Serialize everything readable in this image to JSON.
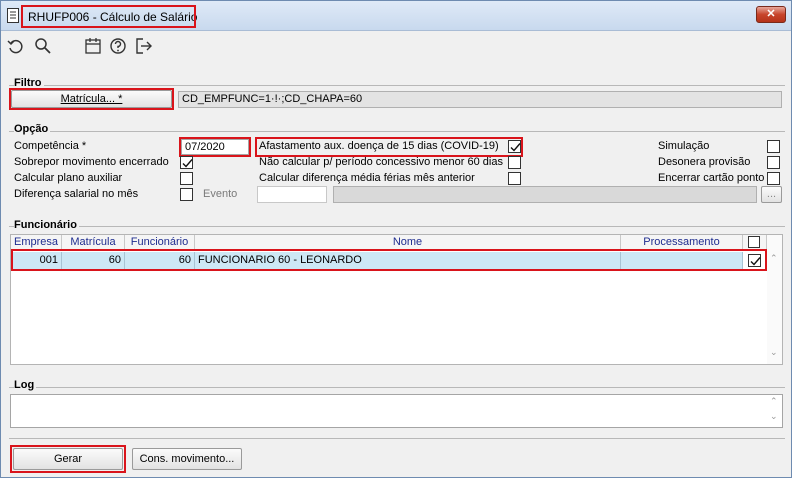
{
  "window": {
    "title": "RHUFP006 - Cálculo de Salário",
    "close_label": "✕"
  },
  "toolbar": {
    "icons": [
      "refresh-icon",
      "search-icon",
      "calendar-icon",
      "help-icon",
      "exit-icon"
    ]
  },
  "filtro": {
    "title": "Filtro",
    "matricula_button": "Matrícula... *",
    "matricula_value": "CD_EMPFUNC=1·!·;CD_CHAPA=60"
  },
  "opcao": {
    "title": "Opção",
    "competencia_label": "Competência *",
    "competencia_value": "07/2020",
    "sobrepor_label": "Sobrepor movimento encerrado",
    "sobrepor_checked": true,
    "plano_label": "Calcular plano auxiliar",
    "plano_checked": false,
    "diferenca_label": "Diferença salarial no mês",
    "diferenca_checked": false,
    "evento_label": "Evento",
    "evento_value": "",
    "evento_desc": "",
    "evento_lookup_label": "...",
    "afastamento_label": "Afastamento aux. doença de 15 dias (COVID-19)",
    "afastamento_checked": true,
    "nao_calcular_label": "Não calcular p/ período concessivo menor 60 dias",
    "nao_calcular_checked": false,
    "media_ferias_label": "Calcular diferença média férias mês anterior",
    "media_ferias_checked": false,
    "simulacao_label": "Simulação",
    "simulacao_checked": false,
    "desonera_label": "Desonera provisão",
    "desonera_checked": false,
    "encerrar_label": "Encerrar cartão ponto",
    "encerrar_checked": false
  },
  "funcionario": {
    "title": "Funcionário",
    "columns": [
      "Empresa",
      "Matrícula",
      "Funcionário",
      "Nome",
      "Processamento"
    ],
    "rows": [
      {
        "empresa": "001",
        "matricula": "60",
        "funcionario": "60",
        "nome": "FUNCIONARIO 60 - LEONARDO",
        "processamento": "",
        "selected": true
      }
    ]
  },
  "log": {
    "title": "Log",
    "value": ""
  },
  "actions": {
    "gerar_label": "Gerar",
    "cons_label": "Cons. movimento..."
  },
  "colors": {
    "highlight": "#d9141b",
    "header_text": "#1f2d8f",
    "row_selected": "#cde8f5"
  }
}
